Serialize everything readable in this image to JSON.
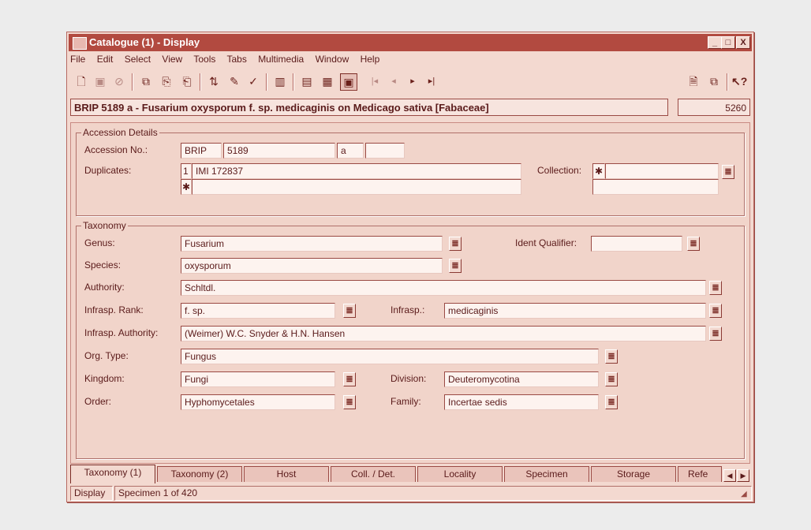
{
  "window": {
    "title": "Catalogue (1) - Display",
    "controls": [
      "_",
      "□",
      "X"
    ]
  },
  "menu": [
    "File",
    "Edit",
    "Select",
    "View",
    "Tools",
    "Tabs",
    "Multimedia",
    "Window",
    "Help"
  ],
  "toolbar": {
    "nav": [
      "|◂",
      "◂",
      "▸",
      "▸|"
    ],
    "help": "?"
  },
  "record": {
    "title": "BRIP 5189 a - Fusarium oxysporum f. sp. medicaginis on Medicago sativa [Fabaceae]",
    "count": "5260"
  },
  "accession": {
    "legend": "Accession Details",
    "accession_label": "Accession No.:",
    "prefix": "BRIP",
    "number": "5189",
    "suffix": "a",
    "extra": "",
    "duplicates_label": "Duplicates:",
    "dup_row1_index": "1",
    "dup_row1_value": "IMI 172837",
    "dup_row2_index": "✱",
    "collection_label": "Collection:",
    "collection_marker": "✱"
  },
  "taxonomy": {
    "legend": "Taxonomy",
    "genus_label": "Genus:",
    "genus": "Fusarium",
    "ident_label": "Ident Qualifier:",
    "ident": "",
    "species_label": "Species:",
    "species": "oxysporum",
    "authority_label": "Authority:",
    "authority": "Schltdl.",
    "rank_label": "Infrasp. Rank:",
    "rank": "f. sp.",
    "infrasp_label": "Infrasp.:",
    "infrasp": "medicaginis",
    "infrasp_auth_label": "Infrasp. Authority:",
    "infrasp_auth": "(Weimer) W.C. Snyder & H.N. Hansen",
    "orgtype_label": "Org. Type:",
    "orgtype": "Fungus",
    "kingdom_label": "Kingdom:",
    "kingdom": "Fungi",
    "division_label": "Division:",
    "division": "Deuteromycotina",
    "order_label": "Order:",
    "order": "Hyphomycetales",
    "family_label": "Family:",
    "family": "Incertae sedis"
  },
  "tabs": [
    "Taxonomy (1)",
    "Taxonomy (2)",
    "Host",
    "Coll. / Det.",
    "Locality",
    "Specimen",
    "Storage",
    "Refe"
  ],
  "status": {
    "mode": "Display",
    "position": "Specimen 1 of 420"
  },
  "colors": {
    "title_bar": "#b24a40",
    "window_bg": "#f3d9d0",
    "field_bg": "#fdf3ef"
  }
}
